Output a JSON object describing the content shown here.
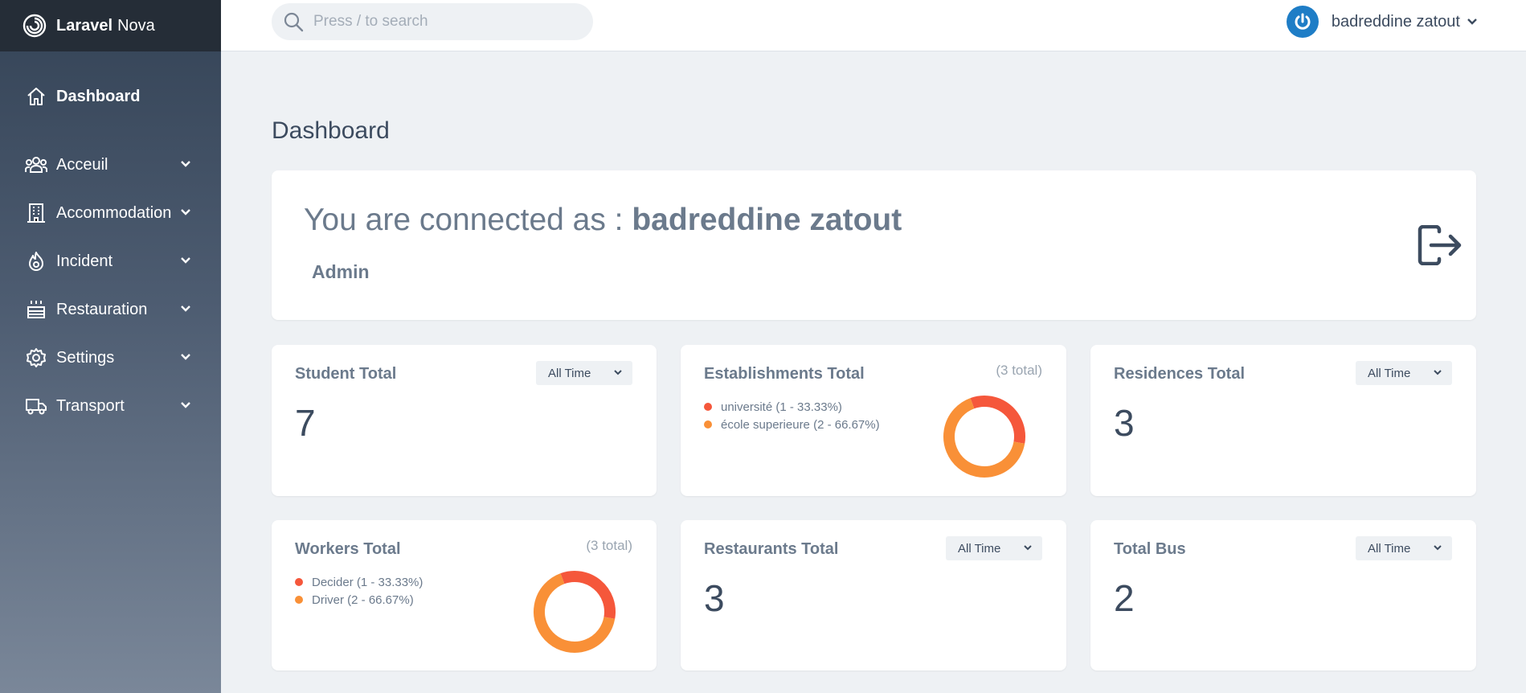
{
  "brand": {
    "name_bold": "Laravel",
    "name_light": "Nova"
  },
  "sidebar": {
    "items": [
      {
        "label": "Dashboard",
        "icon": "home-icon",
        "active": true
      },
      {
        "label": "Acceuil",
        "icon": "users-icon"
      },
      {
        "label": "Accommodation",
        "icon": "building-icon"
      },
      {
        "label": "Incident",
        "icon": "fire-icon"
      },
      {
        "label": "Restauration",
        "icon": "cake-icon"
      },
      {
        "label": "Settings",
        "icon": "gear-icon"
      },
      {
        "label": "Transport",
        "icon": "truck-icon"
      }
    ]
  },
  "header": {
    "search_placeholder": "Press / to search",
    "user_name": "badreddine zatout"
  },
  "main": {
    "title": "Dashboard",
    "welcome": {
      "prefix": "You are connected as : ",
      "name": "badreddine zatout",
      "role": "Admin"
    },
    "cards": {
      "student": {
        "title": "Student Total",
        "value": "7",
        "range": "All Time"
      },
      "establishments": {
        "title": "Establishments Total",
        "total_note": "(3 total)",
        "legend": [
          {
            "label": "université (1 - 33.33%)",
            "color": "#f5573b",
            "value": 1
          },
          {
            "label": "école superieure (2 - 66.67%)",
            "color": "#f99037",
            "value": 2
          }
        ]
      },
      "residences": {
        "title": "Residences Total",
        "value": "3",
        "range": "All Time"
      },
      "workers": {
        "title": "Workers Total",
        "total_note": "(3 total)",
        "legend": [
          {
            "label": "Decider (1 - 33.33%)",
            "color": "#f5573b",
            "value": 1
          },
          {
            "label": "Driver (2 - 66.67%)",
            "color": "#f99037",
            "value": 2
          }
        ]
      },
      "restaurants": {
        "title": "Restaurants Total",
        "value": "3",
        "range": "All Time"
      },
      "bus": {
        "title": "Total Bus",
        "value": "2",
        "range": "All Time"
      }
    }
  },
  "colors": {
    "accent": "#1e7dc6",
    "sidebar_dark": "#252d37",
    "slice_a": "#f5573b",
    "slice_b": "#f99037"
  }
}
